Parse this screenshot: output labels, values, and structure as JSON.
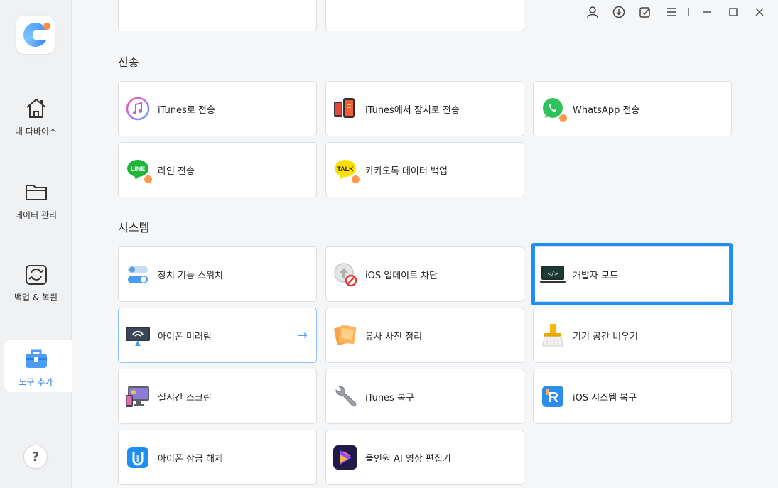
{
  "sidebar": {
    "items": [
      {
        "label": "내 다바이스",
        "icon": "home-icon"
      },
      {
        "label": "데이터 관리",
        "icon": "folder-icon"
      },
      {
        "label": "백업 & 복원",
        "icon": "backup-restore-icon"
      },
      {
        "label": "도구 추가",
        "icon": "toolbox-icon"
      }
    ],
    "help_label": "?"
  },
  "sections": {
    "transfer": {
      "title": "전송",
      "cards": [
        {
          "label": "iTunes로 전송",
          "icon": "itunes-icon"
        },
        {
          "label": "iTunes에서 장치로 전송",
          "icon": "iphone-transfer-icon"
        },
        {
          "label": "WhatsApp 전송",
          "icon": "whatsapp-icon"
        },
        {
          "label": "라인 전송",
          "icon": "line-icon"
        },
        {
          "label": "카카오톡 데이터 백업",
          "icon": "kakaotalk-icon"
        }
      ]
    },
    "system": {
      "title": "시스템",
      "cards": [
        {
          "label": "장치 기능 스위치",
          "icon": "toggle-switch-icon"
        },
        {
          "label": "iOS 업데이트 차단",
          "icon": "block-update-icon"
        },
        {
          "label": "개발자 모드",
          "icon": "developer-terminal-icon"
        },
        {
          "label": "아이폰 미러링",
          "icon": "screen-mirroring-icon"
        },
        {
          "label": "유사 사진 정리",
          "icon": "photos-icon"
        },
        {
          "label": "기기 공간 비우기",
          "icon": "broom-icon"
        },
        {
          "label": "실시간 스크린",
          "icon": "realtime-screen-icon"
        },
        {
          "label": "iTunes 복구",
          "icon": "wrench-icon"
        },
        {
          "label": "iOS 시스템 복구",
          "icon": "reiboot-icon"
        },
        {
          "label": "아이폰 잠금 해제",
          "icon": "unlock-icon"
        },
        {
          "label": "올인원 AI 영상 편집기",
          "icon": "video-editor-icon"
        }
      ]
    }
  },
  "mirroring_arrow": "→",
  "colors": {
    "accent": "#1e8ff2",
    "active_nav": "#2f7bf2"
  }
}
